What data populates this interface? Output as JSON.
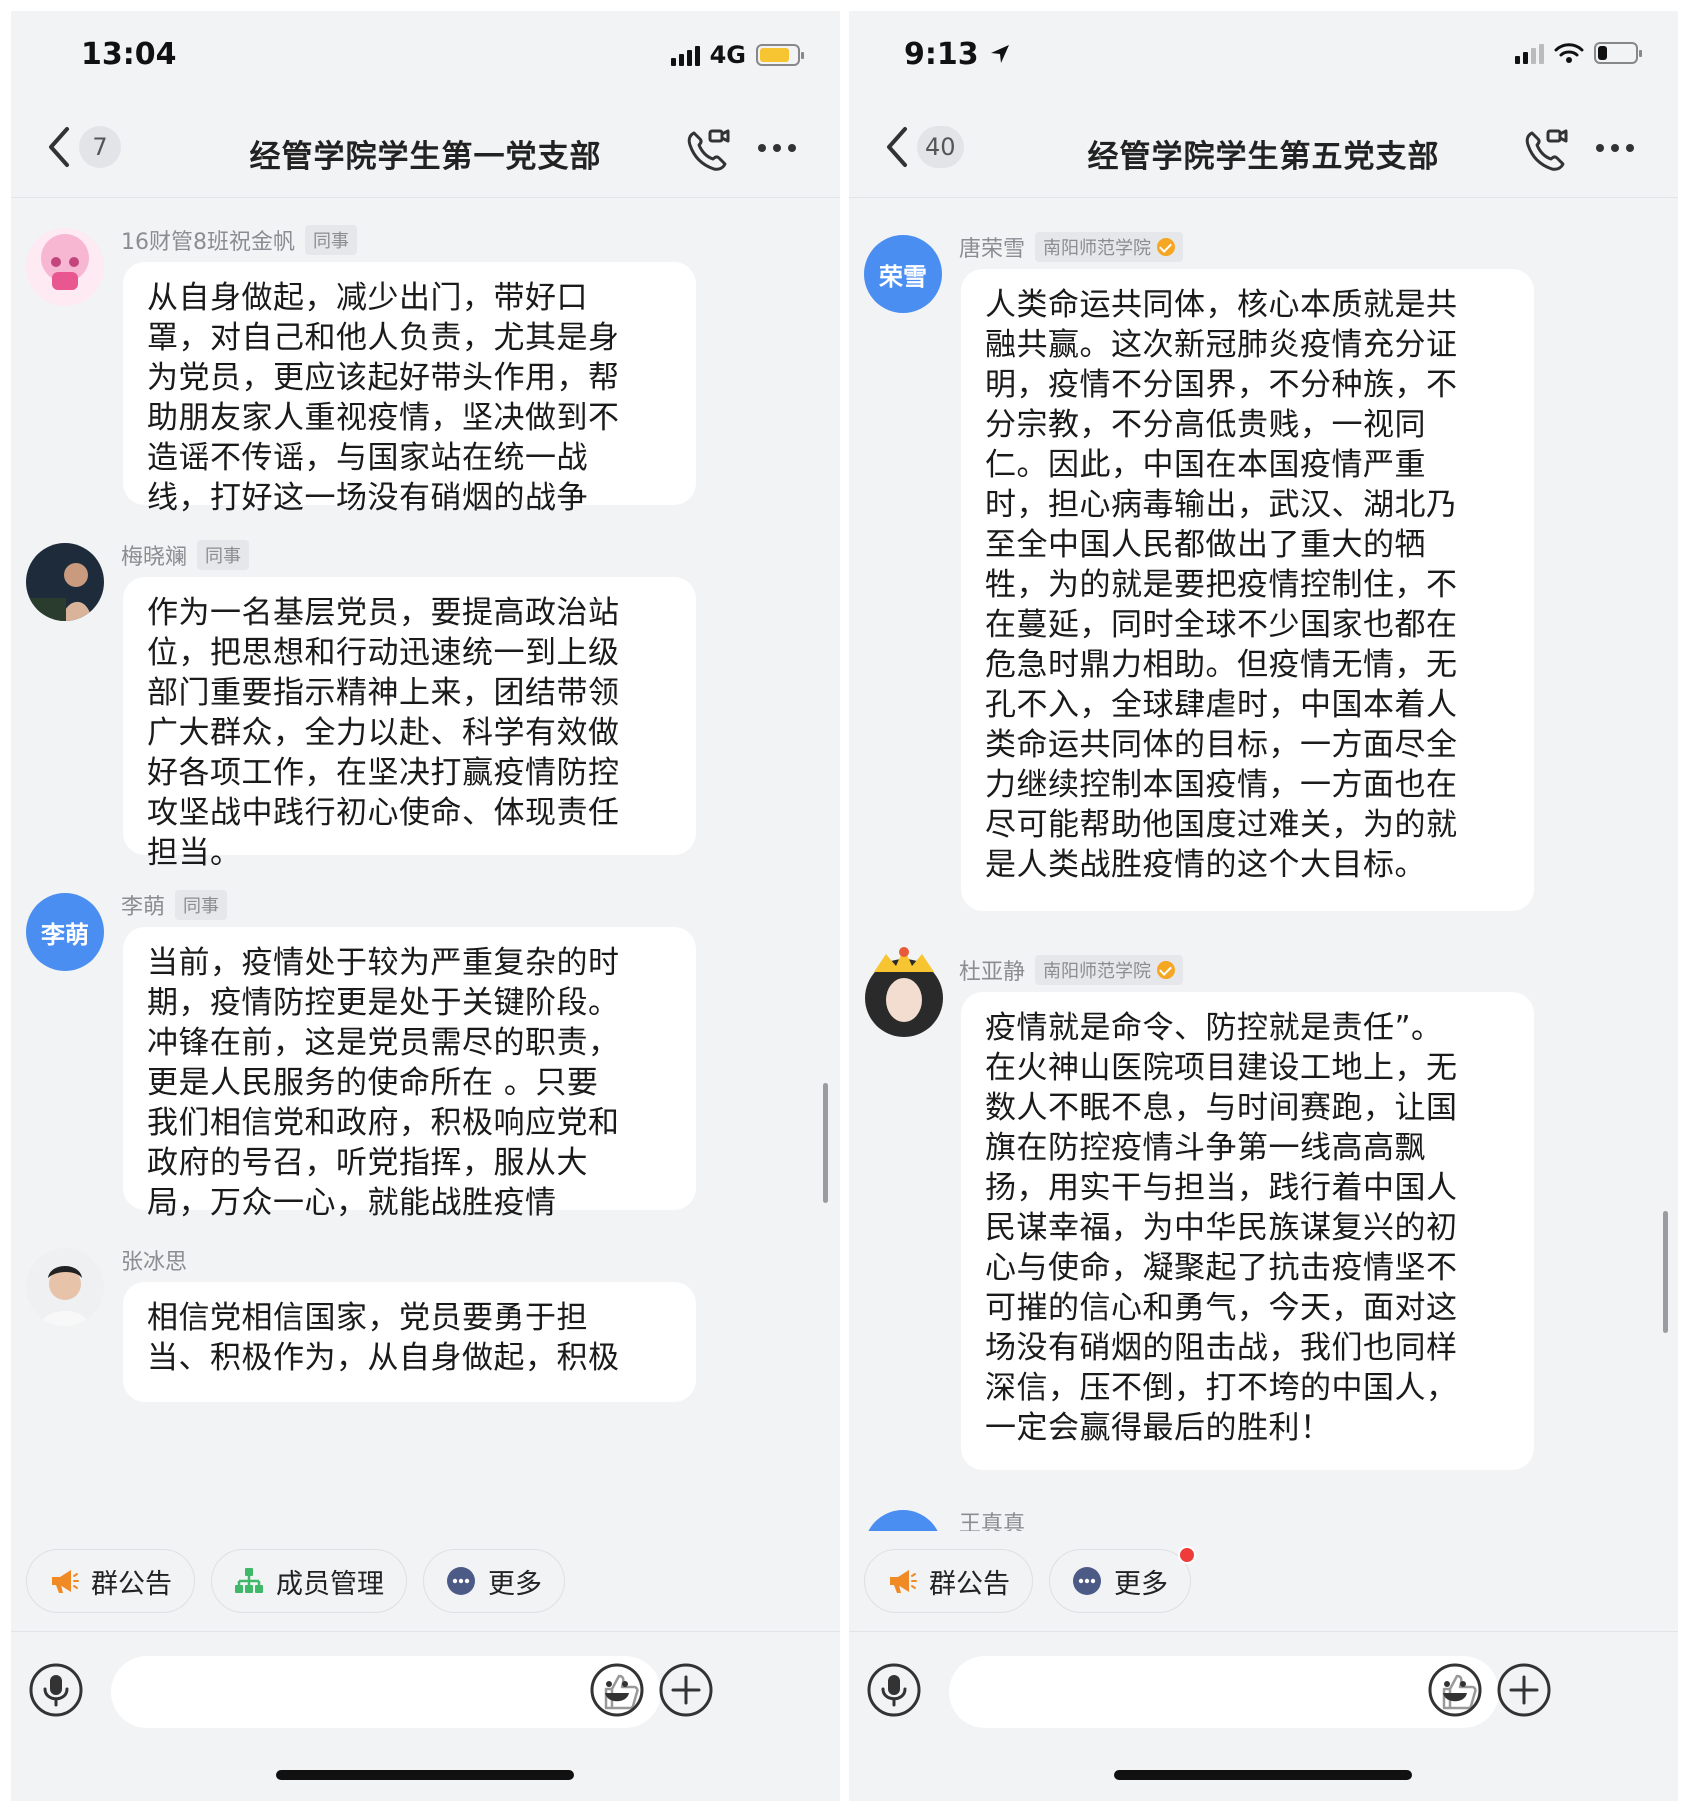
{
  "left": {
    "status": {
      "time": "13:04",
      "network": "4G"
    },
    "nav": {
      "back_count": "7",
      "title": "经管学院学生第一党支部"
    },
    "messages": [
      {
        "name": "16财管8班祝金帆",
        "tag": "同事",
        "text": "从自身做起，减少出门，带好口\n罩，对自己和他人负责，尤其是身\n为党员，更应该起好带头作用，帮\n助朋友家人重视疫情，坚决做到不\n造谣不传谣，与国家站在统一战\n线，打好这一场没有硝烟的战争"
      },
      {
        "name": "梅晓斓",
        "tag": "同事",
        "text": "作为一名基层党员，要提高政治站\n位，把思想和行动迅速统一到上级\n部门重要指示精神上来，团结带领\n广大群众，全力以赴、科学有效做\n好各项工作，在坚决打赢疫情防控\n攻坚战中践行初心使命、体现责任\n担当。"
      },
      {
        "name": "李萌",
        "tag": "同事",
        "avatar_text": "李萌",
        "text": "当前，疫情处于较为严重复杂的时\n期，疫情防控更是处于关键阶段。\n冲锋在前，这是党员需尽的职责，\n更是人民服务的使命所在 。只要\n我们相信党和政府，积极响应党和\n政府的号召，听党指挥，服从大\n局，万众一心，就能战胜疫情"
      },
      {
        "name": "张冰思",
        "text": "相信党相信国家，党员要勇于担\n当、积极作为，从自身做起，积极"
      }
    ],
    "actions": [
      "群公告",
      "成员管理",
      "更多"
    ]
  },
  "right": {
    "status": {
      "time": "9:13"
    },
    "nav": {
      "back_count": "40",
      "title": "经管学院学生第五党支部"
    },
    "messages": [
      {
        "name": "唐荣雪",
        "tag": "南阳师范学院",
        "avatar_text": "荣雪",
        "text": "人类命运共同体，核心本质就是共\n融共赢。这次新冠肺炎疫情充分证\n明，疫情不分国界，不分种族，不\n分宗教，不分高低贵贱，一视同\n仁。因此，中国在本国疫情严重\n时，担心病毒输出，武汉、湖北乃\n至全中国人民都做出了重大的牺\n牲，为的就是要把疫情控制住，不\n在蔓延，同时全球不少国家也都在\n危急时鼎力相助。但疫情无情，无\n孔不入，全球肆虐时，中国本着人\n类命运共同体的目标，一方面尽全\n力继续控制本国疫情，一方面也在\n尽可能帮助他国度过难关，为的就\n是人类战胜疫情的这个大目标。"
      },
      {
        "name": "杜亚静",
        "tag": "南阳师范学院",
        "text": "疫情就是命令、防控就是责任”。\n在火神山医院项目建设工地上，无\n数人不眠不息，与时间赛跑，让国\n旗在防控疫情斗争第一线高高飘\n扬，用实干与担当，践行着中国人\n民谋幸福，为中华民族谋复兴的初\n心与使命，凝聚起了抗击疫情坚不\n可摧的信心和勇气，今天，面对这\n场没有硝烟的阻击战，我们也同样\n深信，压不倒，打不垮的中国人，\n一定会赢得最后的胜利！"
      },
      {
        "name": "王真真"
      }
    ],
    "actions": [
      "群公告",
      "更多"
    ]
  },
  "colors": {
    "accent_blue": "#4a8ef2",
    "badge_red": "#f03b3b",
    "verified_orange": "#f5a623",
    "battery_yellow": "#f7c531"
  },
  "status_levels": {
    "left_battery": 0.8,
    "right_battery": 0.25
  }
}
